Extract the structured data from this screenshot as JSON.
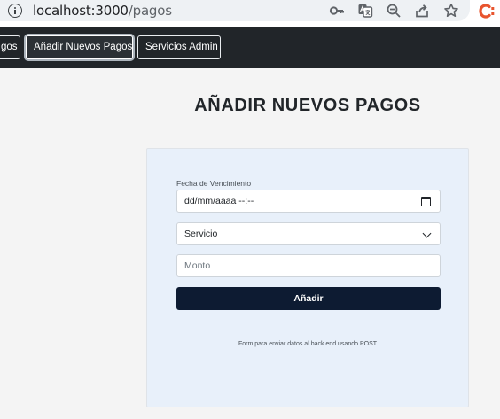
{
  "browser": {
    "url_host": "localhost:3000",
    "url_path": "/pagos"
  },
  "navbar": {
    "items": [
      {
        "label": "gos"
      },
      {
        "label": "Añadir Nuevos Pagos",
        "active": true
      },
      {
        "label": "Servicios Admin"
      }
    ]
  },
  "page": {
    "title": "AÑADIR NUEVOS PAGOS"
  },
  "form": {
    "due_date_label": "Fecha de Vencimiento",
    "due_date_placeholder": "dd/mm/aaaa --:--",
    "service_select_value": "Servicio",
    "amount_placeholder": "Monto",
    "submit_label": "Añadir",
    "note": "Form para enviar datos al back end usando POST"
  },
  "colors": {
    "navbar_bg": "#212529",
    "submit_bg": "#0d1b32",
    "card_bg": "#e8f0fa"
  }
}
